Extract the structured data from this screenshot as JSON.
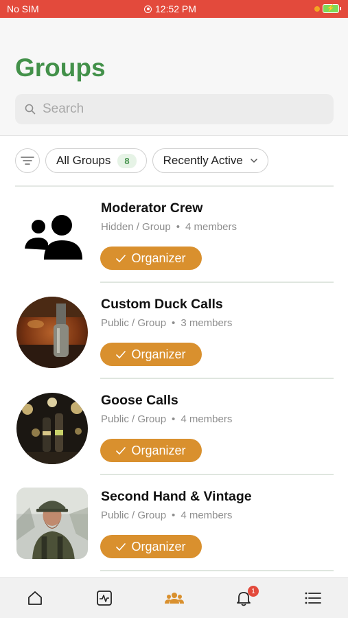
{
  "status_bar": {
    "carrier": "No SIM",
    "time": "12:52 PM"
  },
  "header": {
    "title": "Groups"
  },
  "search": {
    "placeholder": "Search"
  },
  "filters": {
    "all_groups_label": "All Groups",
    "all_groups_count": "8",
    "sort_label": "Recently Active"
  },
  "groups": [
    {
      "name": "Moderator Crew",
      "privacy": "Hidden / Group",
      "members": "4 members",
      "role": "Organizer",
      "avatar": "people-icon"
    },
    {
      "name": "Custom Duck Calls",
      "privacy": "Public / Group",
      "members": "3 members",
      "role": "Organizer",
      "avatar": "duck-call-photo"
    },
    {
      "name": "Goose Calls",
      "privacy": "Public / Group",
      "members": "4 members",
      "role": "Organizer",
      "avatar": "goose-calls-photo"
    },
    {
      "name": "Second Hand & Vintage",
      "privacy": "Public / Group",
      "members": "4 members",
      "role": "Organizer",
      "avatar": "hunter-photo"
    }
  ],
  "tab_bar": {
    "items": [
      "home-icon",
      "activity-icon",
      "groups-icon",
      "notifications-icon",
      "menu-icon"
    ],
    "notification_count": "1"
  },
  "colors": {
    "accent": "#43914a",
    "organizer": "#d9902e",
    "status_bar": "#e34a3c"
  }
}
